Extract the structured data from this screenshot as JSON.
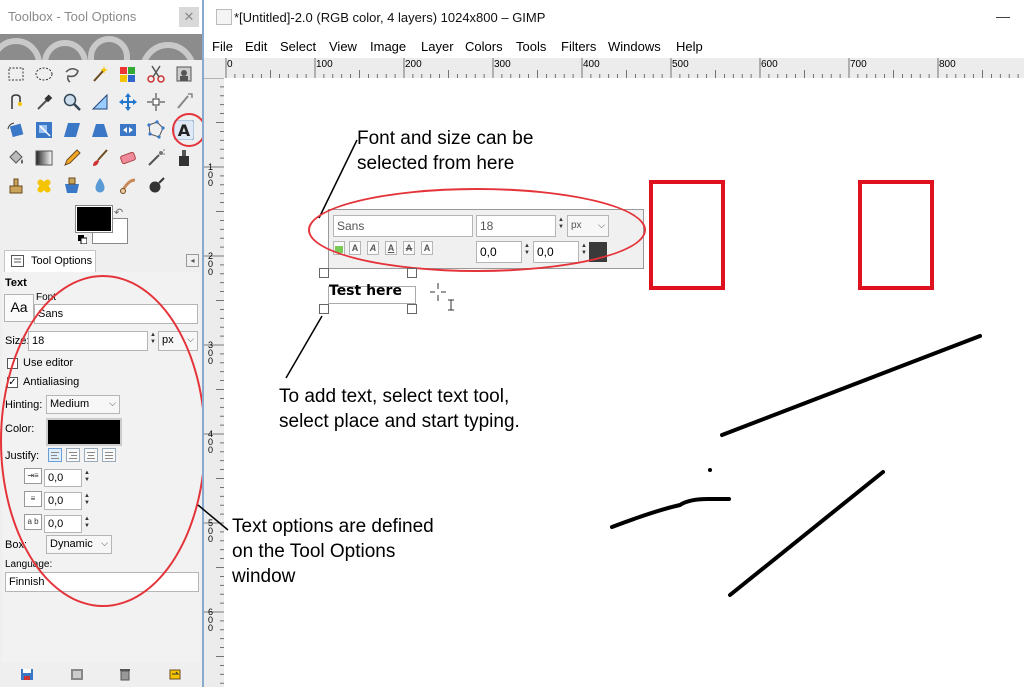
{
  "toolbox": {
    "title": "Toolbox - Tool Options",
    "close_label": "✕",
    "colors": {
      "foreground": "#000000",
      "background": "#ffffff"
    },
    "tool_options_tab": "Tool Options",
    "text_section_label": "Text",
    "font": {
      "label": "Font",
      "preview": "Aa",
      "value": "Sans"
    },
    "size": {
      "label": "Size:",
      "value": "18",
      "unit": "px"
    },
    "use_editor": {
      "label": "Use editor",
      "checked": false
    },
    "antialiasing": {
      "label": "Antialiasing",
      "checked": true
    },
    "hinting": {
      "label": "Hinting:",
      "value": "Medium"
    },
    "color": {
      "label": "Color:",
      "value": "#000000"
    },
    "justify": {
      "label": "Justify:"
    },
    "indent": {
      "value": "0,0"
    },
    "line_spacing": {
      "value": "0,0"
    },
    "letter_spacing": {
      "value": "0,0"
    },
    "box": {
      "label": "Box:",
      "value": "Dynamic"
    },
    "language": {
      "label": "Language:",
      "value": "Finnish"
    }
  },
  "gimp": {
    "title": "*[Untitled]-2.0 (RGB color, 4 layers) 1024x800 – GIMP",
    "minimize": "—",
    "menus": [
      "File",
      "Edit",
      "Select",
      "View",
      "Image",
      "Layer",
      "Colors",
      "Tools",
      "Filters",
      "Windows",
      "Help"
    ],
    "h_ruler": [
      "0",
      "100",
      "200",
      "300",
      "400",
      "500",
      "600",
      "700",
      "800"
    ],
    "v_ruler": [
      "1\n0\n0",
      "2\n0\n0",
      "3\n0\n0",
      "4\n0\n0",
      "5\n0\n0",
      "6\n0\n0"
    ],
    "text_toolbar": {
      "font": "Sans",
      "size": "18",
      "unit": "px",
      "baseline": "0,0",
      "kerning": "0,0",
      "color": "#3a3a3a",
      "style_buttons": [
        "A",
        "A",
        "A",
        "A",
        "A"
      ]
    },
    "canvas_text": "Test here"
  },
  "annotations": {
    "font_size": "Font and size can be\nselected from here",
    "add_text": "To add text, select text tool,\nselect place and start typing.",
    "text_options": "Text options are defined\non the Tool Options\nwindow"
  },
  "accent": "#e4343a"
}
